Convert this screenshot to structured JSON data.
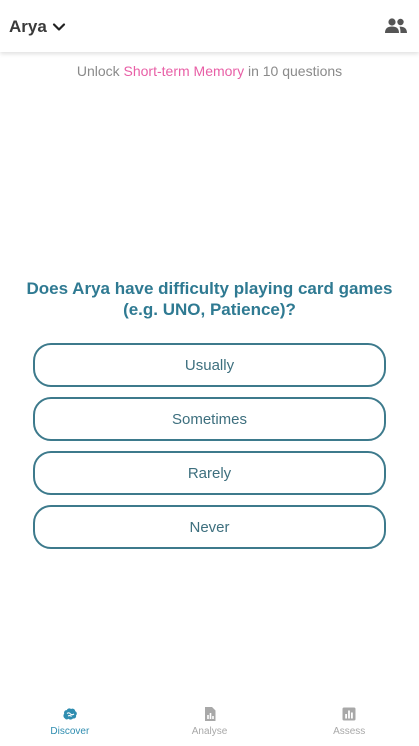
{
  "header": {
    "profile_name": "Arya"
  },
  "unlock": {
    "prefix": "Unlock",
    "skill": "Short-term Memory",
    "suffix": "in 10 questions"
  },
  "question": {
    "line1": "Does Arya have difficulty playing card games",
    "line2": "(e.g. UNO, Patience)?"
  },
  "answers": [
    "Usually",
    "Sometimes",
    "Rarely",
    "Never"
  ],
  "nav": [
    {
      "label": "Discover",
      "icon": "brain-icon",
      "active": true
    },
    {
      "label": "Analyse",
      "icon": "report-icon",
      "active": false
    },
    {
      "label": "Assess",
      "icon": "bar-chart-icon",
      "active": false
    }
  ],
  "colors": {
    "accent_teal": "#2f7a92",
    "skill_pink": "#e85fa6",
    "nav_active": "#2f8db0",
    "nav_inactive": "#a8a8a8"
  }
}
